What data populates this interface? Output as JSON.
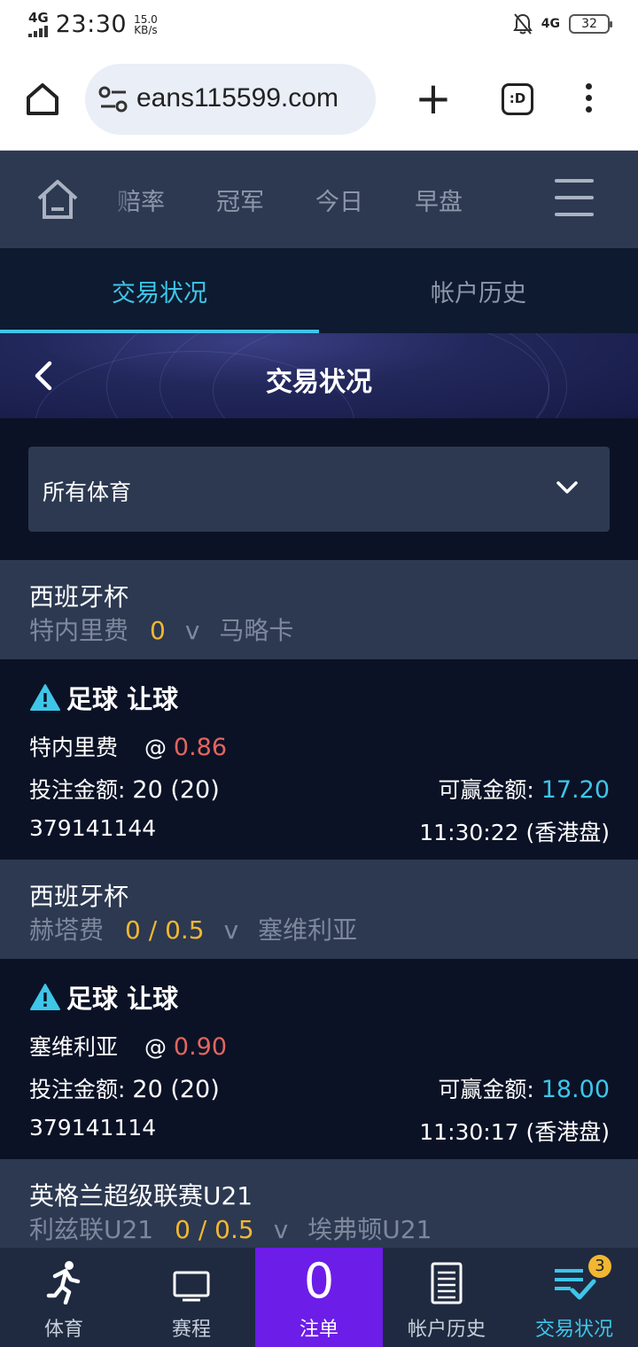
{
  "status_bar": {
    "network": "4G",
    "time": "23:30",
    "speed_value": "15.0",
    "speed_unit": "KB/s",
    "network_right": "4G",
    "battery": "32"
  },
  "browser": {
    "url": "eans115599.com",
    "tabs_label": ":D"
  },
  "site_nav": {
    "items": [
      "赔率",
      "冠军",
      "今日",
      "早盘"
    ]
  },
  "tabs": [
    {
      "label": "交易状况",
      "active": true
    },
    {
      "label": "帐户历史",
      "active": false
    }
  ],
  "page_title": "交易状况",
  "filter": {
    "selected": "所有体育"
  },
  "bets": [
    {
      "league": "西班牙杯",
      "home": "特内里费",
      "handicap": "0",
      "vs": "v",
      "away": "马略卡",
      "bet_type": "足球 让球",
      "selection": "特内里费",
      "at": "@",
      "odds": "0.86",
      "stake_label": "投注金额:",
      "stake": "20 (20)",
      "win_label": "可赢金额:",
      "win": "17.20",
      "id": "379141144",
      "time": "11:30:22 (香港盘)"
    },
    {
      "league": "西班牙杯",
      "home": "赫塔费",
      "handicap": "0 / 0.5",
      "vs": "v",
      "away": "塞维利亚",
      "bet_type": "足球 让球",
      "selection": "塞维利亚",
      "at": "@",
      "odds": "0.90",
      "stake_label": "投注金额:",
      "stake": "20 (20)",
      "win_label": "可赢金额:",
      "win": "18.00",
      "id": "379141114",
      "time": "11:30:17 (香港盘)"
    },
    {
      "league": "英格兰超级联赛U21",
      "home": "利兹联U21",
      "handicap": "0 / 0.5",
      "vs": "v",
      "away": "埃弗顿U21"
    }
  ],
  "bottom_nav": {
    "sports": "体育",
    "schedule": "赛程",
    "slip_count": "0",
    "slip": "注单",
    "history": "帐户历史",
    "status": "交易状况",
    "status_badge": "3"
  },
  "colors": {
    "accent": "#3ec6e8",
    "handicap": "#f2b731",
    "odds": "#e3665e",
    "slip_bg": "#6c1de8",
    "panel": "#2c3951",
    "background": "#0b1226"
  }
}
